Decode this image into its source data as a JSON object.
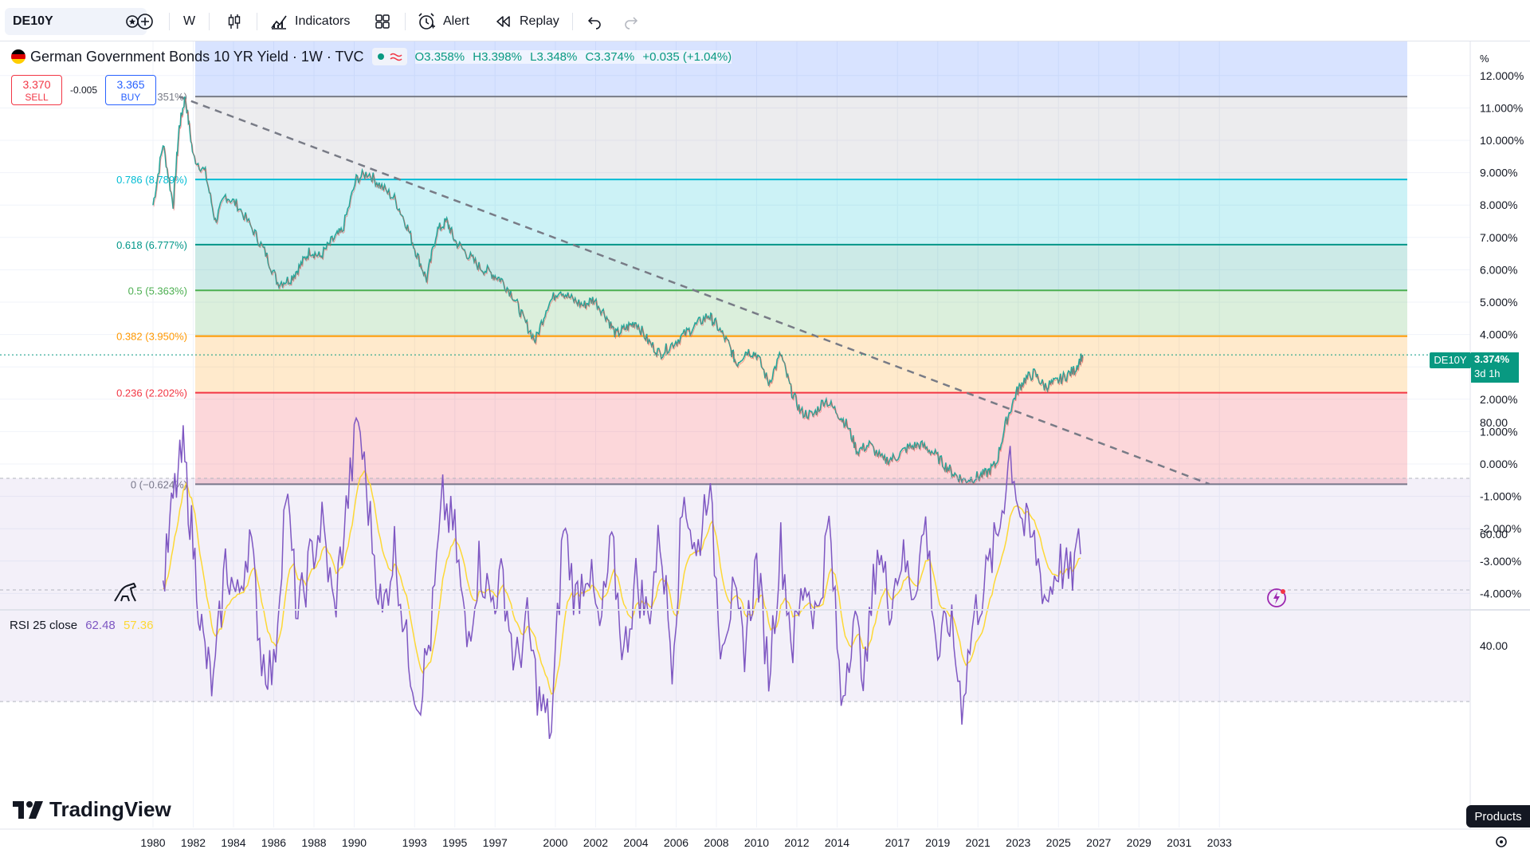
{
  "toolbar": {
    "symbol": "DE10Y",
    "interval": "W",
    "indicators_label": "Indicators",
    "alert_label": "Alert",
    "replay_label": "Replay"
  },
  "legend": {
    "title": "German Government Bonds 10 YR Yield · 1W · TVC",
    "open": "O3.358%",
    "high": "H3.398%",
    "low": "L3.348%",
    "close": "C3.374%",
    "change": "+0.035 (+1.04%)"
  },
  "trade": {
    "sell_price": "3.370",
    "sell_label": "SELL",
    "spread": "-0.005",
    "buy_price": "3.365",
    "buy_label": "BUY"
  },
  "price_tag": {
    "symbol": "DE10Y",
    "value": "3.374%",
    "countdown": "3d 1h"
  },
  "rsi": {
    "label": "RSI 25 close",
    "value": "62.48",
    "ma": "57.36",
    "ticks": [
      "80.00",
      "60.00",
      "40.00"
    ]
  },
  "products_label": "Products",
  "brand": "TradingView",
  "chart_data": {
    "type": "line",
    "title": "German Government Bonds 10 YR Yield · 1W · TVC",
    "y_unit": "%",
    "ylim": [
      -4.3,
      13.0
    ],
    "y_ticks": [
      "12.000%",
      "11.000%",
      "10.000%",
      "9.000%",
      "8.000%",
      "7.000%",
      "6.000%",
      "5.000%",
      "4.000%",
      "3.000%",
      "2.000%",
      "1.000%",
      "0.000%",
      "-1.000%",
      "-2.000%",
      "-3.000%",
      "-4.000%"
    ],
    "x_ticks": [
      "1980",
      "1982",
      "1984",
      "1986",
      "1988",
      "1990",
      "1993",
      "1995",
      "1997",
      "2000",
      "2002",
      "2004",
      "2006",
      "2008",
      "2010",
      "2012",
      "2014",
      "2017",
      "2019",
      "2021",
      "2023",
      "2025",
      "2027",
      "2029",
      "2031",
      "2033"
    ],
    "fib_levels": [
      {
        "ratio": 1,
        "label": "1 (11.351%)",
        "value": 11.351,
        "color": "#787b86"
      },
      {
        "ratio": 0.786,
        "label": "0.786 (8.789%)",
        "value": 8.789,
        "color": "#00bcd4"
      },
      {
        "ratio": 0.618,
        "label": "0.618 (6.777%)",
        "value": 6.777,
        "color": "#009688"
      },
      {
        "ratio": 0.5,
        "label": "0.5 (5.363%)",
        "value": 5.363,
        "color": "#4caf50"
      },
      {
        "ratio": 0.382,
        "label": "0.382 (3.950%)",
        "value": 3.95,
        "color": "#ff9800"
      },
      {
        "ratio": 0.236,
        "label": "0.236 (2.202%)",
        "value": 2.202,
        "color": "#f23645"
      },
      {
        "ratio": 0,
        "label": "0 (−0.624%)",
        "value": -0.624,
        "color": "#787b86"
      }
    ],
    "trendline": {
      "x": [
        1981.3,
        2032.5
      ],
      "y": [
        11.35,
        -0.62
      ],
      "style": "dashed"
    },
    "series": [
      {
        "name": "DE10Y",
        "x": [
          1980.0,
          1980.5,
          1981.0,
          1981.3,
          1981.6,
          1982.0,
          1982.6,
          1983.1,
          1983.6,
          1984.2,
          1985.0,
          1985.6,
          1986.2,
          1986.8,
          1987.3,
          1987.8,
          1988.3,
          1988.9,
          1989.4,
          1990.1,
          1990.7,
          1991.3,
          1992.0,
          1992.6,
          1993.1,
          1993.6,
          1994.1,
          1994.6,
          1995.0,
          1995.6,
          1996.2,
          1996.8,
          1997.3,
          1997.9,
          1998.4,
          1999.0,
          1999.6,
          2000.2,
          2000.8,
          2001.4,
          2001.9,
          2002.5,
          2003.0,
          2003.5,
          2004.0,
          2004.6,
          2005.2,
          2005.8,
          2006.4,
          2007.0,
          2007.6,
          2008.0,
          2008.6,
          2009.0,
          2009.5,
          2010.0,
          2010.6,
          2011.2,
          2011.7,
          2012.2,
          2012.8,
          2013.4,
          2014.0,
          2014.5,
          2015.0,
          2015.6,
          2016.3,
          2016.9,
          2017.5,
          2018.1,
          2018.7,
          2019.3,
          2019.8,
          2020.3,
          2020.9,
          2021.4,
          2021.9,
          2022.4,
          2022.9,
          2023.3,
          2023.8,
          2024.3,
          2024.8,
          2025.3,
          2025.8,
          2026.2
        ],
        "y": [
          8.0,
          9.9,
          8.0,
          10.4,
          11.35,
          9.5,
          9.0,
          7.5,
          8.3,
          8.0,
          7.2,
          6.5,
          5.6,
          5.7,
          6.1,
          6.6,
          6.4,
          6.9,
          7.2,
          8.8,
          9.0,
          8.6,
          8.2,
          7.4,
          6.5,
          5.7,
          7.2,
          7.5,
          6.9,
          6.5,
          6.1,
          5.9,
          5.7,
          5.2,
          4.5,
          3.8,
          4.9,
          5.4,
          5.1,
          4.9,
          5.1,
          4.6,
          4.0,
          4.2,
          4.4,
          3.8,
          3.4,
          3.7,
          4.0,
          4.3,
          4.6,
          4.3,
          3.7,
          3.1,
          3.5,
          3.4,
          2.5,
          3.4,
          2.3,
          1.6,
          1.5,
          2.0,
          1.6,
          1.2,
          0.4,
          0.6,
          0.1,
          0.2,
          0.5,
          0.6,
          0.4,
          0.0,
          -0.3,
          -0.5,
          -0.4,
          -0.3,
          0.0,
          1.3,
          2.2,
          2.6,
          2.8,
          2.4,
          2.5,
          2.7,
          2.9,
          3.37
        ]
      },
      {
        "name": "RSI 25 close",
        "x": [
          1980.5,
          1981.0,
          1981.5,
          1982.0,
          1982.5,
          1983.0,
          1983.6,
          1984.2,
          1984.8,
          1985.4,
          1986.0,
          1986.6,
          1987.2,
          1987.8,
          1988.4,
          1989.0,
          1989.6,
          1990.2,
          1990.8,
          1991.4,
          1992.0,
          1992.6,
          1993.2,
          1993.8,
          1994.4,
          1995.0,
          1995.6,
          1996.2,
          1996.8,
          1997.4,
          1998.0,
          1998.6,
          1999.2,
          1999.8,
          2000.4,
          2001.0,
          2001.6,
          2002.2,
          2002.8,
          2003.4,
          2004.0,
          2004.6,
          2005.2,
          2005.8,
          2006.4,
          2007.0,
          2007.6,
          2008.2,
          2008.8,
          2009.4,
          2010.0,
          2010.6,
          2011.2,
          2011.8,
          2012.4,
          2013.0,
          2013.6,
          2014.2,
          2014.8,
          2015.4,
          2016.0,
          2016.6,
          2017.2,
          2017.8,
          2018.4,
          2019.0,
          2019.6,
          2020.2,
          2020.8,
          2021.4,
          2022.0,
          2022.6,
          2023.2,
          2023.8,
          2024.4,
          2025.0,
          2025.6,
          2026.2
        ],
        "y": [
          50,
          66,
          75,
          58,
          40,
          32,
          55,
          48,
          60,
          38,
          35,
          68,
          45,
          55,
          62,
          46,
          64,
          81,
          62,
          45,
          58,
          40,
          30,
          42,
          66,
          60,
          40,
          55,
          48,
          52,
          36,
          44,
          30,
          25,
          62,
          48,
          55,
          42,
          58,
          38,
          52,
          45,
          60,
          38,
          68,
          55,
          70,
          42,
          48,
          40,
          55,
          35,
          58,
          40,
          52,
          45,
          62,
          30,
          45,
          35,
          58,
          48,
          56,
          50,
          62,
          38,
          45,
          30,
          45,
          52,
          60,
          75,
          62,
          58,
          48,
          55,
          52,
          60
        ]
      }
    ]
  }
}
